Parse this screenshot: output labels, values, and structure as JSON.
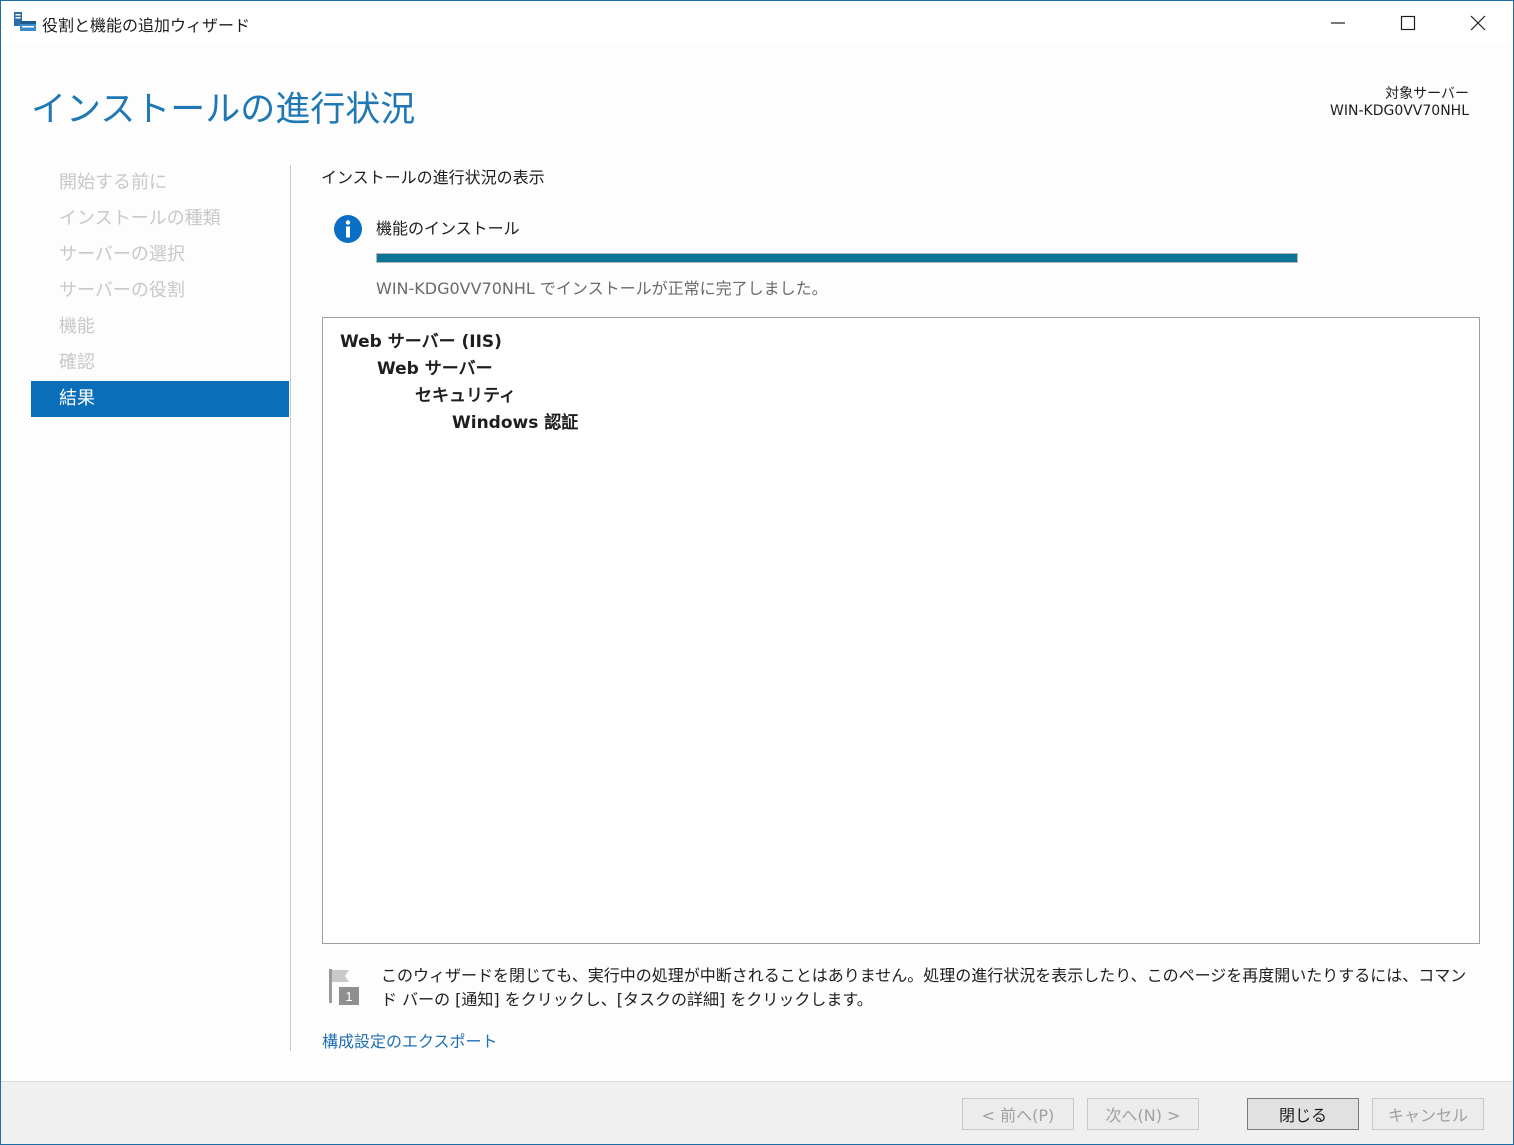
{
  "window": {
    "title": "役割と機能の追加ウィザード"
  },
  "header": {
    "page_title": "インストールの進行状況",
    "target_server_label": "対象サーバー",
    "target_server_name": "WIN-KDG0VV70NHL"
  },
  "sidebar": {
    "items": [
      {
        "label": "開始する前に",
        "active": false
      },
      {
        "label": "インストールの種類",
        "active": false
      },
      {
        "label": "サーバーの選択",
        "active": false
      },
      {
        "label": "サーバーの役割",
        "active": false
      },
      {
        "label": "機能",
        "active": false
      },
      {
        "label": "確認",
        "active": false
      },
      {
        "label": "結果",
        "active": true
      }
    ]
  },
  "content": {
    "section_title": "インストールの進行状況の表示",
    "feature_install_label": "機能のインストール",
    "progress_percent": 100,
    "status_message": "WIN-KDG0VV70NHL でインストールが正常に完了しました。",
    "results_tree": [
      {
        "label": "Web サーバー (IIS)",
        "level": 0
      },
      {
        "label": "Web サーバー",
        "level": 1
      },
      {
        "label": "セキュリティ",
        "level": 2
      },
      {
        "label": "Windows 認証",
        "level": 3
      }
    ],
    "notification_badge": "1",
    "note_text": "このウィザードを閉じても、実行中の処理が中断されることはありません。処理の進行状況を表示したり、このページを再度開いたりするには、コマンド バーの [通知] をクリックし、[タスクの詳細] をクリックします。",
    "export_link": "構成設定のエクスポート"
  },
  "footer": {
    "prev_label": "< 前へ(P)",
    "next_label": "次へ(N) >",
    "close_label": "閉じる",
    "cancel_label": "キャンセル"
  },
  "colors": {
    "accent": "#0a6eb9",
    "title_blue": "#1f78b4",
    "progress_fill": "#0b7596",
    "link": "#1f6fb5"
  }
}
